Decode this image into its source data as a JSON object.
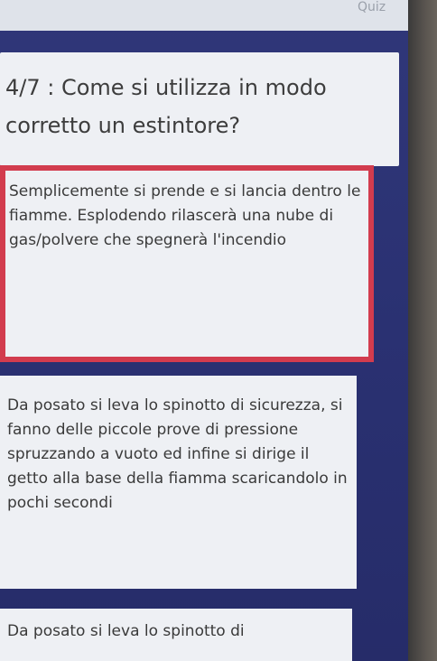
{
  "top_bar": {
    "label": "Quiz"
  },
  "question": {
    "text": "4/7 : Come si utilizza in modo corretto un estintore?"
  },
  "answers": [
    {
      "text": "Semplicemente si prende e si lancia dentro le fiamme. Esplodendo rilascerà una nube di gas/polvere che spegnerà l'incendio",
      "selected": true
    },
    {
      "text": "Da posato si leva lo spinotto di sicurezza, si fanno delle piccole prove di pressione spruzzando a vuoto ed infine si dirige il getto alla base della fiamma scaricandolo in pochi secondi",
      "selected": false
    },
    {
      "text": "Da posato si leva lo spinotto di",
      "selected": false
    }
  ],
  "colors": {
    "background": "#2a3172",
    "card": "#eef0f4",
    "selected_border": "#d23c4e",
    "text": "#3a3a3a"
  }
}
